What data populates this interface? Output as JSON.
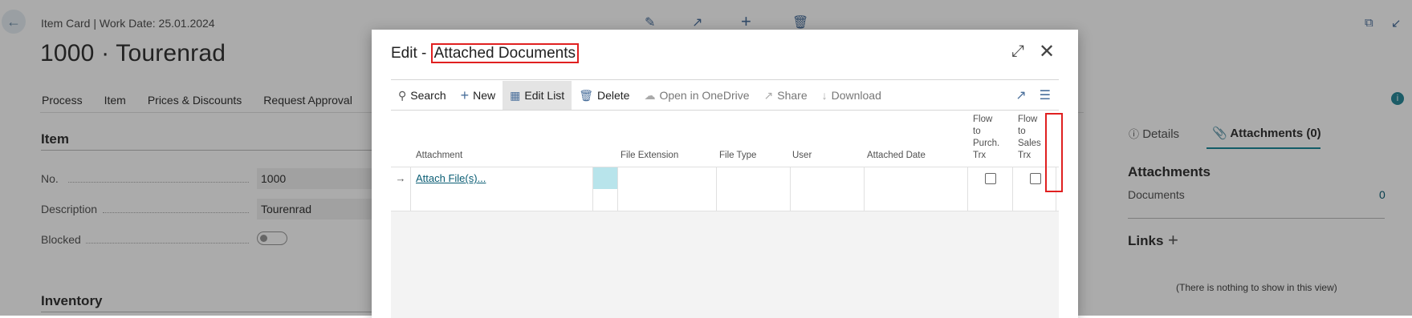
{
  "page": {
    "breadcrumb": "Item Card | Work Date: 25.01.2024",
    "title": "1000 · Tourenrad",
    "actions": [
      "Process",
      "Item",
      "Prices & Discounts",
      "Request Approval"
    ]
  },
  "item_section": {
    "title": "Item",
    "fields": [
      {
        "label": "No.",
        "value": "1000"
      },
      {
        "label": "Description",
        "value": "Tourenrad"
      },
      {
        "label": "Blocked",
        "value": ""
      }
    ]
  },
  "inventory_section": {
    "title": "Inventory"
  },
  "factbox": {
    "tabs": [
      "Details",
      "Attachments (0)"
    ],
    "attachments_title": "Attachments",
    "documents_label": "Documents",
    "documents_count": "0",
    "links_title": "Links",
    "links_empty": "(There is nothing to show in this view)"
  },
  "dialog": {
    "title_prefix": "Edit - ",
    "title_highlight": "Attached Documents",
    "toolbar": {
      "search": "Search",
      "new": "New",
      "edit_list": "Edit List",
      "delete": "Delete",
      "open_onedrive": "Open in OneDrive",
      "share": "Share",
      "download": "Download"
    },
    "columns": {
      "attachment": "Attachment",
      "file_extension": "File Extension",
      "file_type": "File Type",
      "user": "User",
      "attached_date": "Attached Date",
      "flow_purch_1": "Flow",
      "flow_purch_2": "to",
      "flow_purch_3": "Purch.",
      "flow_purch_4": "Trx",
      "flow_sales_1": "Flow",
      "flow_sales_2": "to",
      "flow_sales_3": "Sales",
      "flow_sales_4": "Trx"
    },
    "rows": [
      {
        "attachment": "Attach File(s)...",
        "file_extension": "",
        "file_type": "",
        "user": "",
        "attached_date": ""
      }
    ]
  },
  "colors": {
    "accent": "#0a5d74",
    "highlight_border": "#e02020",
    "selected_cell": "#b8e4eb"
  }
}
